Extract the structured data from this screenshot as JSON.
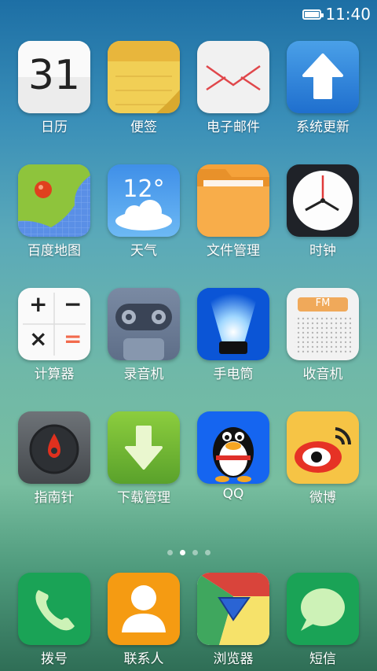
{
  "status": {
    "time": "11:40",
    "battery_level": 1.0
  },
  "apps": [
    {
      "label": "日历",
      "icon": "calendar-icon",
      "day": "31"
    },
    {
      "label": "便签",
      "icon": "notes-icon"
    },
    {
      "label": "电子邮件",
      "icon": "mail-icon"
    },
    {
      "label": "系统更新",
      "icon": "update-icon"
    },
    {
      "label": "百度地图",
      "icon": "map-icon"
    },
    {
      "label": "天气",
      "icon": "weather-icon",
      "temp": "12°"
    },
    {
      "label": "文件管理",
      "icon": "folder-icon"
    },
    {
      "label": "时钟",
      "icon": "clock-icon"
    },
    {
      "label": "计算器",
      "icon": "calculator-icon",
      "symbols": [
        "+",
        "−",
        "×",
        "="
      ]
    },
    {
      "label": "录音机",
      "icon": "recorder-icon"
    },
    {
      "label": "手电筒",
      "icon": "flashlight-icon"
    },
    {
      "label": "收音机",
      "icon": "radio-icon",
      "band": "FM"
    },
    {
      "label": "指南针",
      "icon": "compass-icon"
    },
    {
      "label": "下载管理",
      "icon": "download-icon"
    },
    {
      "label": "QQ",
      "icon": "qq-icon"
    },
    {
      "label": "微博",
      "icon": "weibo-icon"
    }
  ],
  "pager": {
    "pages": 4,
    "current": 2
  },
  "dock": [
    {
      "label": "拨号",
      "icon": "phone-icon"
    },
    {
      "label": "联系人",
      "icon": "contacts-icon"
    },
    {
      "label": "浏览器",
      "icon": "browser-icon"
    },
    {
      "label": "短信",
      "icon": "sms-icon"
    }
  ],
  "colors": {
    "accent_green": "#1aa356",
    "accent_orange": "#f59b12",
    "qq_blue": "#1565f0"
  }
}
